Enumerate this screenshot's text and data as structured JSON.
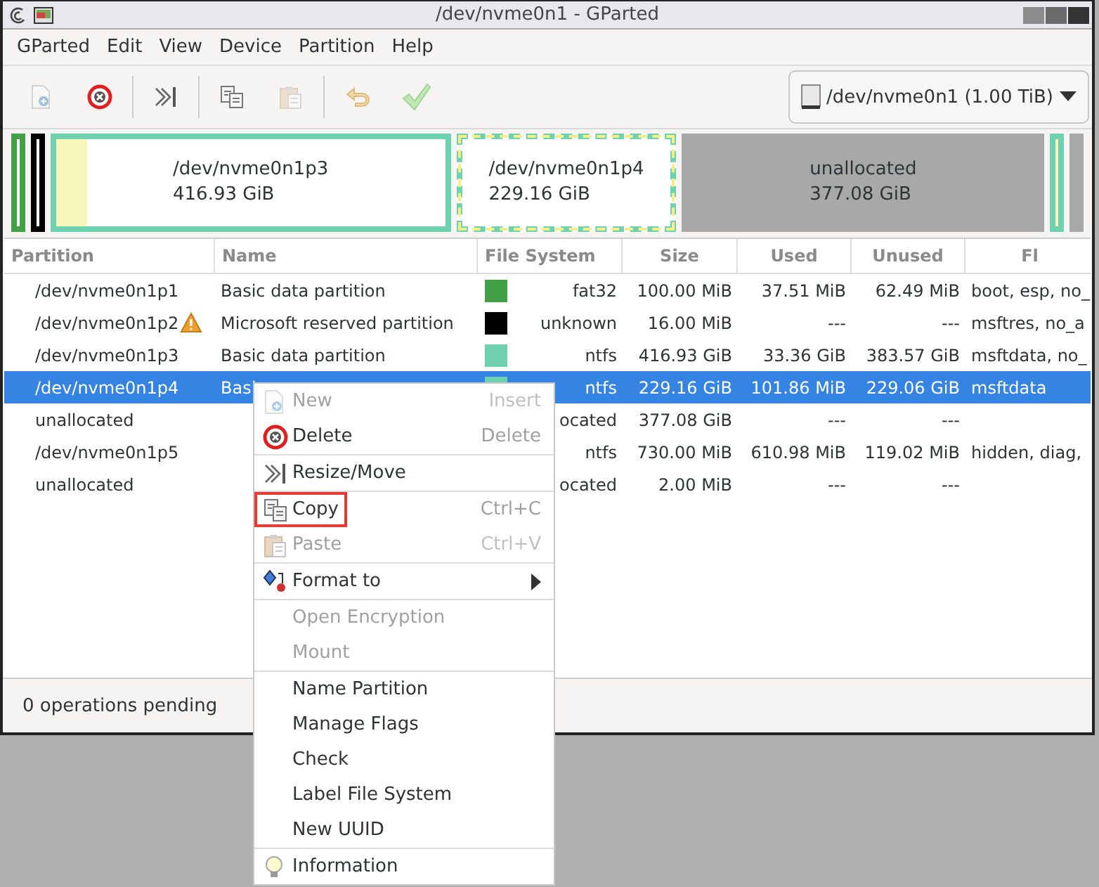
{
  "window": {
    "title": "/dev/nvme0n1 - GParted"
  },
  "menubar": [
    "GParted",
    "Edit",
    "View",
    "Device",
    "Partition",
    "Help"
  ],
  "toolbar": [
    {
      "disabled": true
    },
    {
      "disabled": false
    },
    {
      "disabled": false
    },
    {
      "disabled": false
    },
    {
      "disabled": true
    },
    {
      "disabled": true
    },
    {
      "disabled": true
    }
  ],
  "device_selector": {
    "value": "/dev/nvme0n1 (1.00 TiB)"
  },
  "disk_map": [
    {
      "kind": "partition",
      "color": "#43a047",
      "selected": false
    },
    {
      "kind": "partition",
      "color": "#000000",
      "selected": false
    },
    {
      "kind": "partition",
      "color": "#6fd1af",
      "selected": false,
      "level": 0.08,
      "name": "/dev/nvme0n1p3",
      "size": "416.93 GiB"
    },
    {
      "kind": "partition",
      "color": "#6fd1af",
      "selected": true,
      "name": "/dev/nvme0n1p4",
      "size": "229.16 GiB"
    },
    {
      "kind": "unallocated",
      "name": "unallocated",
      "size": "377.08 GiB"
    },
    {
      "kind": "partition",
      "color": "#6fd1af",
      "selected": false,
      "level": 0.84
    },
    {
      "kind": "unallocated"
    }
  ],
  "table": {
    "columns": [
      "Partition",
      "Name",
      "File System",
      "Size",
      "Used",
      "Unused",
      "Fl"
    ],
    "rows": [
      {
        "partition": "/dev/nvme0n1p1",
        "warning": false,
        "name": "Basic data partition",
        "color": "#43a047",
        "file_system": "fat32",
        "size": "100.00 MiB",
        "used": "37.51 MiB",
        "unused": "62.49 MiB",
        "flags": "boot, esp, no_",
        "selected": false
      },
      {
        "partition": "/dev/nvme0n1p2",
        "warning": true,
        "name": "Microsoft reserved partition",
        "color": "#000000",
        "file_system": "unknown",
        "size": "16.00 MiB",
        "used": "---",
        "unused": "---",
        "flags": "msftres, no_a",
        "selected": false
      },
      {
        "partition": "/dev/nvme0n1p3",
        "warning": false,
        "name": "Basic data partition",
        "color": "#6fd1af",
        "file_system": "ntfs",
        "size": "416.93 GiB",
        "used": "33.36 GiB",
        "unused": "383.57 GiB",
        "flags": "msftdata, no_",
        "selected": false
      },
      {
        "partition": "/dev/nvme0n1p4",
        "warning": false,
        "name": "Basi",
        "color": "#6fd1af",
        "file_system": "ntfs",
        "size": "229.16 GiB",
        "used": "101.86 MiB",
        "unused": "229.06 GiB",
        "flags": "msftdata",
        "selected": true
      },
      {
        "partition": "unallocated",
        "warning": false,
        "file_system": "ocated",
        "size": "377.08 GiB",
        "used": "---",
        "unused": "---",
        "selected": false
      },
      {
        "partition": "/dev/nvme0n1p5",
        "warning": false,
        "file_system": "ntfs",
        "size": "730.00 MiB",
        "used": "610.98 MiB",
        "unused": "119.02 MiB",
        "flags": "hidden, diag,",
        "selected": false
      },
      {
        "partition": "unallocated",
        "warning": false,
        "file_system": "ocated",
        "size": "2.00 MiB",
        "used": "---",
        "unused": "---",
        "selected": false
      }
    ]
  },
  "status_bar": "0 operations pending",
  "context_menu": {
    "groups": [
      [
        {
          "label": "New",
          "shortcut": "Insert",
          "disabled": true,
          "highlighted": false
        },
        {
          "label": "Delete",
          "shortcut": "Delete",
          "disabled": false,
          "highlighted": false
        }
      ],
      [
        {
          "label": "Resize/Move",
          "disabled": false,
          "highlighted": false
        }
      ],
      [
        {
          "label": "Copy",
          "shortcut": "Ctrl+C",
          "disabled": false,
          "highlighted": true
        },
        {
          "label": "Paste",
          "shortcut": "Ctrl+V",
          "disabled": true,
          "highlighted": false
        }
      ],
      [
        {
          "label": "Format to",
          "submenu": true,
          "disabled": false,
          "highlighted": false
        }
      ],
      [
        {
          "label": "Open Encryption",
          "disabled": true,
          "highlighted": false
        },
        {
          "label": "Mount",
          "disabled": true,
          "highlighted": false
        }
      ],
      [
        {
          "label": "Name Partition",
          "disabled": false,
          "highlighted": false
        },
        {
          "label": "Manage Flags",
          "disabled": false,
          "highlighted": false
        },
        {
          "label": "Check",
          "disabled": false,
          "highlighted": false
        },
        {
          "label": "Label File System",
          "disabled": false,
          "highlighted": false
        },
        {
          "label": "New UUID",
          "disabled": false,
          "highlighted": false
        }
      ],
      [
        {
          "label": "Information",
          "disabled": false,
          "highlighted": false
        }
      ]
    ]
  }
}
